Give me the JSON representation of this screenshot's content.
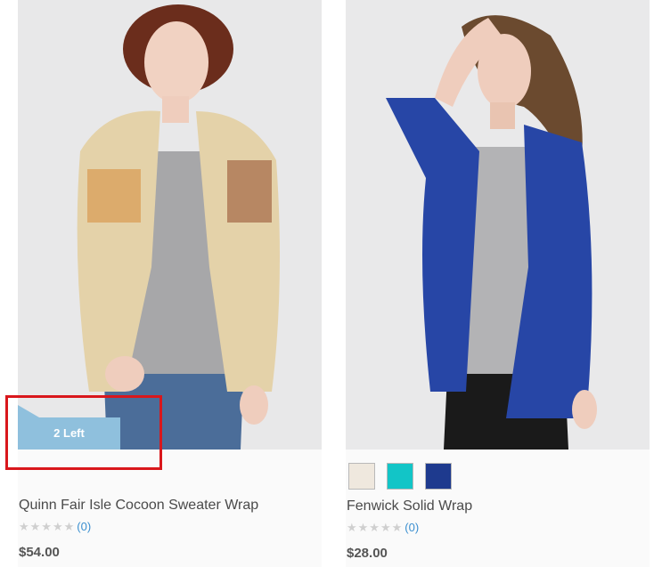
{
  "products": [
    {
      "name": "Quinn Fair Isle Cocoon Sweater Wrap",
      "badge": "2 Left",
      "stars_glyphs": "★★★★★",
      "review_count": "(0)",
      "price": "$54.00",
      "image_icon": "product-photo-cardigan-beige"
    },
    {
      "name": "Fenwick Solid Wrap",
      "stars_glyphs": "★★★★★",
      "review_count": "(0)",
      "price": "$28.00",
      "image_icon": "product-photo-cardigan-blue",
      "swatches": [
        "#efe8de",
        "#12c5c7",
        "#1e3a8e"
      ]
    }
  ],
  "colors": {
    "badge": "#8fc0dd",
    "highlight": "#d9171c",
    "link": "#3a8fd0"
  }
}
